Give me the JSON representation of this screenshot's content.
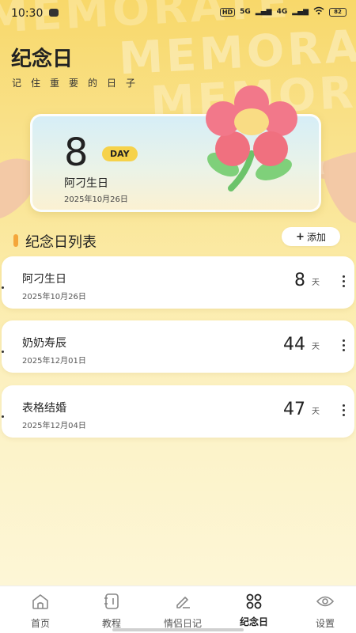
{
  "status_bar": {
    "time": "10:30",
    "indicators": [
      "HD",
      "5G",
      "4G"
    ],
    "battery": "82"
  },
  "page": {
    "title": "纪念日",
    "subtitle": "记住重要的日子",
    "background_words": [
      "MEMORATION",
      "MEMORATE"
    ]
  },
  "hero": {
    "days": "8",
    "unit_badge": "DAY",
    "name": "阿刁生日",
    "date": "2025年10月26日"
  },
  "section": {
    "title": "纪念日列表",
    "add_label": "添加",
    "add_icon": "plus-icon"
  },
  "items": [
    {
      "name": "阿刁生日",
      "date": "2025年10月26日",
      "days": "8",
      "unit": "天"
    },
    {
      "name": "奶奶寿辰",
      "date": "2025年12月01日",
      "days": "44",
      "unit": "天"
    },
    {
      "name": "表格结婚",
      "date": "2025年12月04日",
      "days": "47",
      "unit": "天"
    }
  ],
  "nav": {
    "items": [
      {
        "label": "首页",
        "icon": "home-icon"
      },
      {
        "label": "教程",
        "icon": "notebook-icon"
      },
      {
        "label": "情侣日记",
        "icon": "pen-icon"
      },
      {
        "label": "纪念日",
        "icon": "grid-icon",
        "active": true
      },
      {
        "label": "设置",
        "icon": "settings-icon"
      }
    ]
  },
  "colors": {
    "accent": "#f4a63a",
    "badge": "#f6d24a",
    "background_top": "#f8d86a",
    "background_bottom": "#fdf6d6"
  }
}
